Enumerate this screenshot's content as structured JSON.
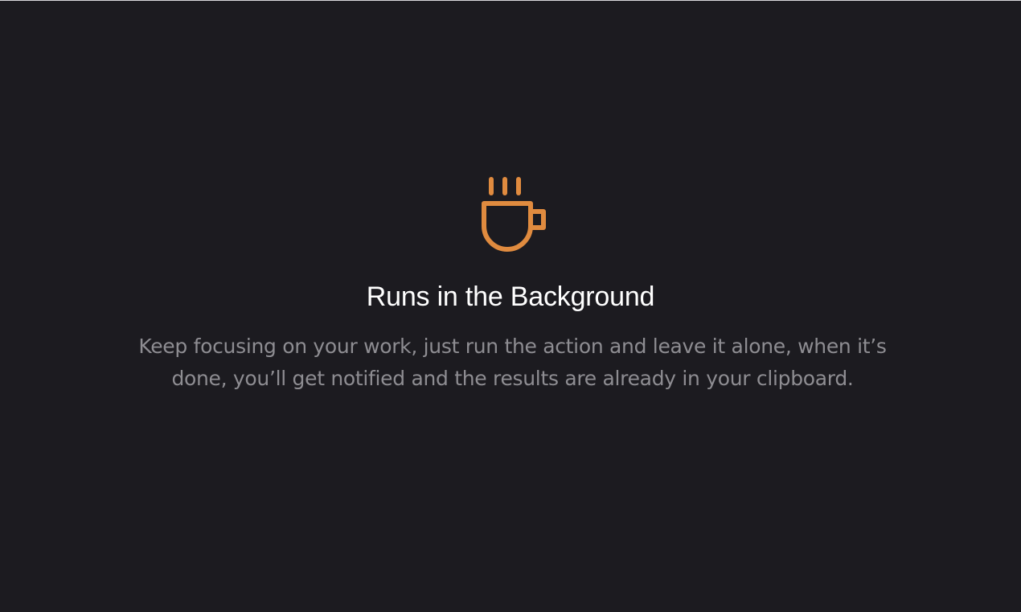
{
  "feature": {
    "icon": "coffee-cup-icon",
    "accent_color": "#e08b3f",
    "title": "Runs in the Background",
    "description": "Keep focusing on your work, just run the action and leave it alone, when it’s done, you’ll get notified and the results are already in your clipboard."
  }
}
